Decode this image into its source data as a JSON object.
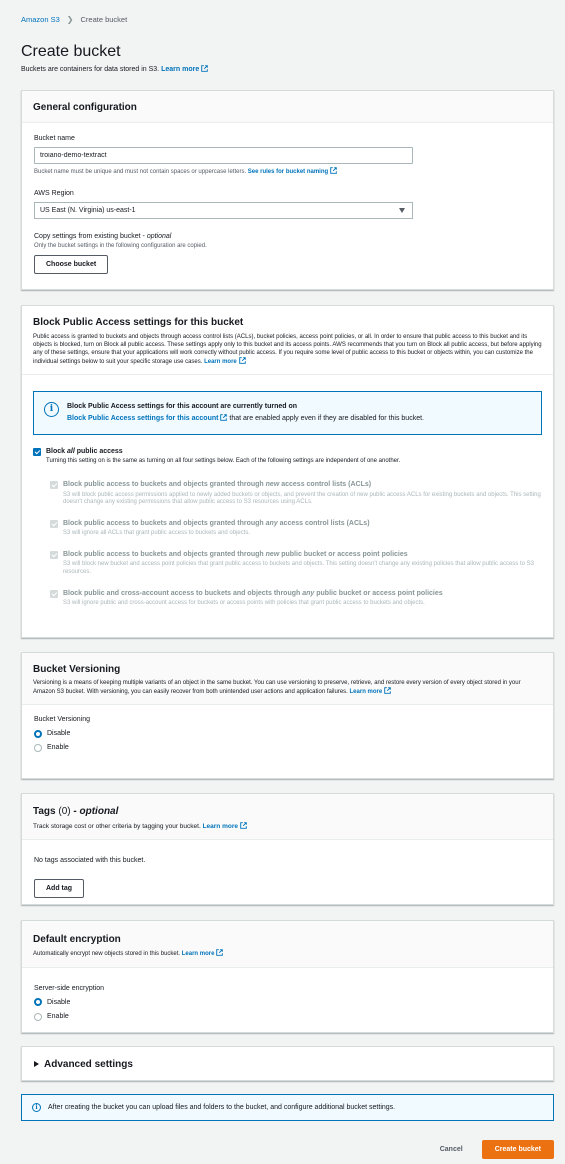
{
  "breadcrumb": {
    "root": "Amazon S3",
    "current": "Create bucket"
  },
  "header": {
    "title": "Create bucket",
    "subtitle": "Buckets are containers for data stored in S3.",
    "learn_more": "Learn more"
  },
  "general": {
    "title": "General configuration",
    "bucket_name_label": "Bucket name",
    "bucket_name_value": "troiano-demo-textract",
    "bucket_name_help": "Bucket name must be unique and must not contain spaces or uppercase letters.",
    "bucket_name_rules_link": "See rules for bucket naming",
    "region_label": "AWS Region",
    "region_value": "US East (N. Virginia) us-east-1",
    "copy_label": "Copy settings from existing bucket - ",
    "copy_optional": "optional",
    "copy_help": "Only the bucket settings in the following configuration are copied.",
    "choose_button": "Choose bucket"
  },
  "block_public": {
    "title": "Block Public Access settings for this bucket",
    "desc": "Public access is granted to buckets and objects through access control lists (ACLs), bucket policies, access point policies, or all. In order to ensure that public access to this bucket and its objects is blocked, turn on Block all public access. These settings apply only to this bucket and its access points. AWS recommends that you turn on Block all public access, but before applying any of these settings, ensure that your applications will work correctly without public access. If you require some level of public access to this bucket or objects within, you can customize the individual settings below to suit your specific storage use cases.",
    "learn_more": "Learn more",
    "info_title": "Block Public Access settings for this account are currently turned on",
    "info_link": "Block Public Access settings for this account",
    "info_text": "that are enabled apply even if they are disabled for this bucket.",
    "block_all_prefix": "Block ",
    "block_all_em": "all",
    "block_all_suffix": " public access",
    "block_all_desc": "Turning this setting on is the same as turning on all four settings below. Each of the following settings are independent of one another.",
    "items": [
      {
        "pre": "Block public access to buckets and objects granted through ",
        "em": "new",
        "post": " access control lists (ACLs)",
        "desc": "S3 will block public access permissions applied to newly added buckets or objects, and prevent the creation of new public access ACLs for existing buckets and objects. This setting doesn't change any existing permissions that allow public access to S3 resources using ACLs."
      },
      {
        "pre": "Block public access to buckets and objects granted through ",
        "em": "any",
        "post": " access control lists (ACLs)",
        "desc": "S3 will ignore all ACLs that grant public access to buckets and objects."
      },
      {
        "pre": "Block public access to buckets and objects granted through ",
        "em": "new",
        "post": " public bucket or access point policies",
        "desc": "S3 will block new bucket and access point policies that grant public access to buckets and objects. This setting doesn't change any existing policies that allow public access to S3 resources."
      },
      {
        "pre": "Block public and cross-account access to buckets and objects through ",
        "em": "any",
        "post": " public bucket or access point policies",
        "desc": "S3 will ignore public and cross-account access for buckets or access points with policies that grant public access to buckets and objects."
      }
    ]
  },
  "versioning": {
    "title": "Bucket Versioning",
    "desc": "Versioning is a means of keeping multiple variants of an object in the same bucket. You can use versioning to preserve, retrieve, and restore every version of every object stored in your Amazon S3 bucket. With versioning, you can easily recover from both unintended user actions and application failures.",
    "learn_more": "Learn more",
    "label": "Bucket Versioning",
    "options": [
      "Disable",
      "Enable"
    ]
  },
  "tags": {
    "title": "Tags",
    "count": "(0)",
    "optional": " - optional",
    "desc": "Track storage cost or other criteria by tagging your bucket.",
    "learn_more": "Learn more",
    "empty": "No tags associated with this bucket.",
    "add_button": "Add tag"
  },
  "encryption": {
    "title": "Default encryption",
    "desc": "Automatically encrypt new objects stored in this bucket.",
    "learn_more": "Learn more",
    "label": "Server-side encryption",
    "options": [
      "Disable",
      "Enable"
    ]
  },
  "advanced": {
    "title": "Advanced settings"
  },
  "bottom_info": {
    "text": "After creating the bucket you can upload files and folders to the bucket, and configure additional bucket settings."
  },
  "actions": {
    "cancel": "Cancel",
    "create": "Create bucket"
  },
  "colors": {
    "link": "#0073bb",
    "primary": "#ec7211"
  }
}
